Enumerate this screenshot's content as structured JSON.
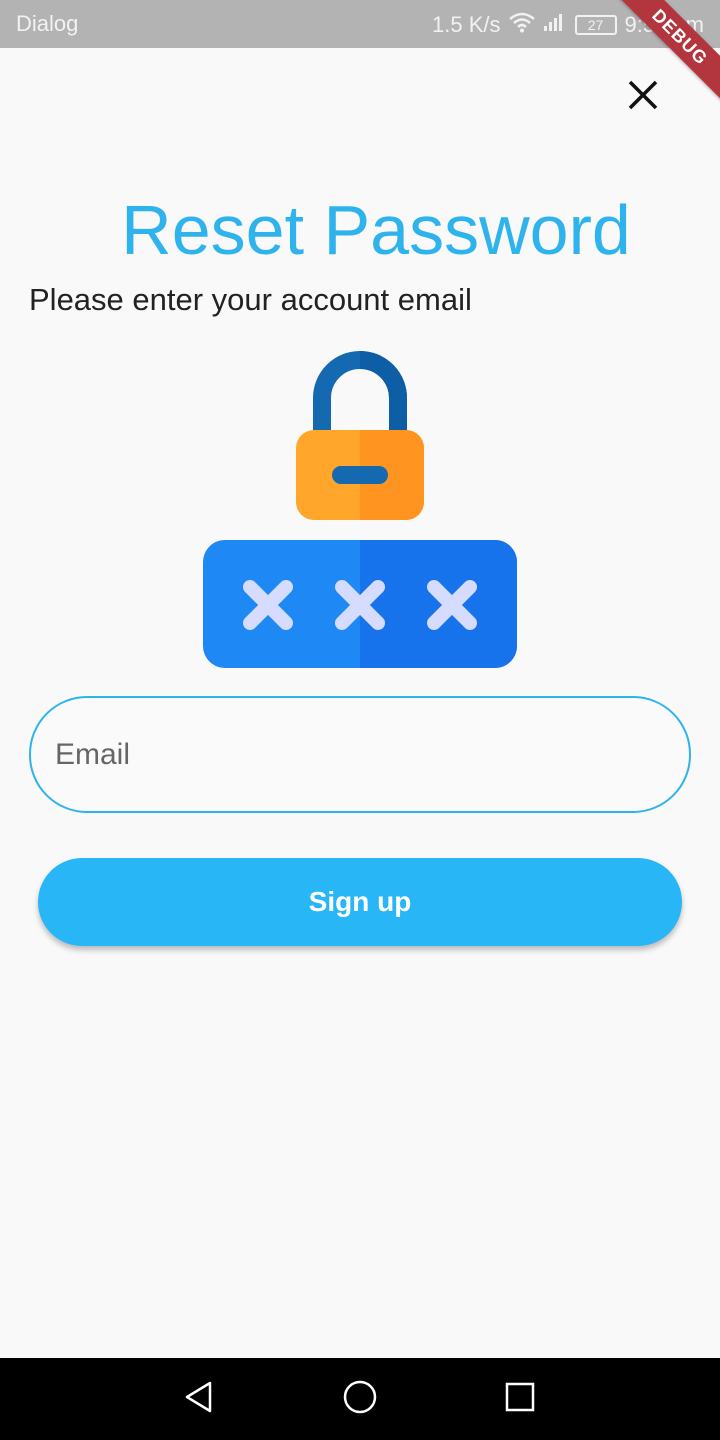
{
  "status_bar": {
    "app_name": "Dialog",
    "network_speed": "1.5 K/s",
    "battery": "27",
    "time": "9:54 am"
  },
  "debug_banner": "DEBUG",
  "dialog": {
    "title": "Reset Password",
    "subtitle": "Please enter your account email",
    "email_placeholder": "Email",
    "submit_label": "Sign up"
  },
  "icons": {
    "close": "close-icon",
    "illustration": "lock-password-icon",
    "back": "back-icon",
    "home": "home-icon",
    "recents": "recents-icon",
    "wifi": "wifi-icon",
    "signal": "signal-icon",
    "battery": "battery-icon"
  },
  "colors": {
    "accent": "#2fb3ec",
    "button": "#29b6f6",
    "status_bar": "#b3b3b3",
    "debug": "#b3353d"
  }
}
